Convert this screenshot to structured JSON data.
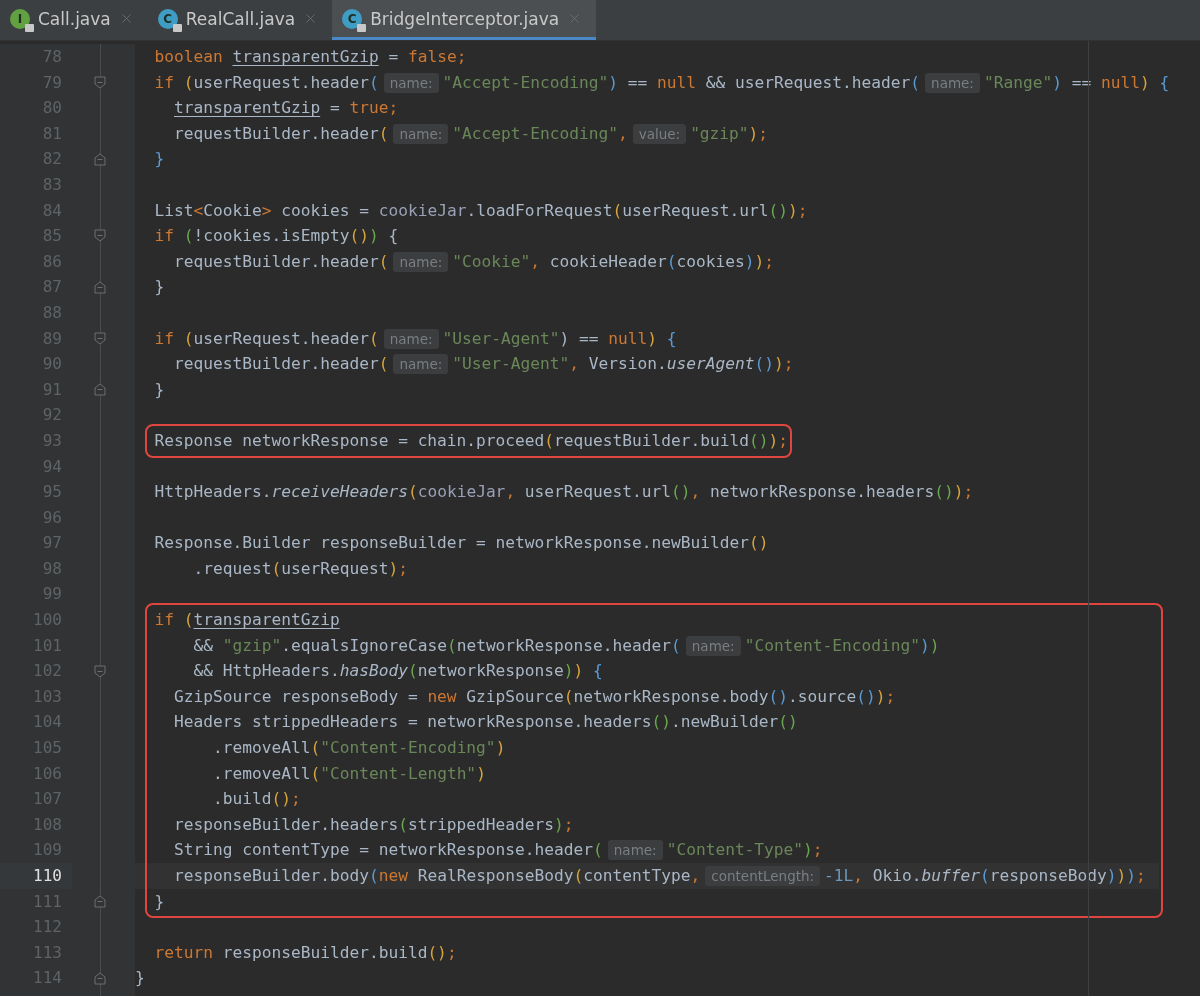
{
  "tabs": [
    {
      "label": "Call.java",
      "kind": "interface",
      "icon_letter": "I",
      "selected": false
    },
    {
      "label": "RealCall.java",
      "kind": "class",
      "icon_letter": "C",
      "selected": false
    },
    {
      "label": "BridgeInterceptor.java",
      "kind": "class",
      "icon_letter": "C",
      "selected": true
    }
  ],
  "segments": [
    {
      "kind": "code",
      "lines": [
        {
          "number": "78",
          "current": false,
          "tokens": [
            {
              "kind": "kw",
              "text": "  boolean "
            },
            {
              "kind": "var",
              "text": "transparentGzip"
            },
            {
              "kind": "txt",
              "text": " = "
            },
            {
              "kind": "kw",
              "text": "false"
            },
            {
              "kind": "punct",
              "text": ";"
            }
          ]
        },
        {
          "number": "79",
          "current": false,
          "fold": {
            "kind": "start"
          },
          "tokens": [
            {
              "kind": "kw",
              "text": "  if "
            },
            {
              "kind": "p1",
              "text": "("
            },
            {
              "kind": "txt",
              "text": "userRequest.header"
            },
            {
              "kind": "p2",
              "text": "("
            },
            {
              "kind": "hint",
              "text": "name:"
            },
            {
              "kind": "str",
              "text": "\"Accept-Encoding\""
            },
            {
              "kind": "p2",
              "text": ")"
            },
            {
              "kind": "txt",
              "text": " == "
            },
            {
              "kind": "kw",
              "text": "null"
            },
            {
              "kind": "txt",
              "text": " && userRequest.header"
            },
            {
              "kind": "p2",
              "text": "("
            },
            {
              "kind": "hint",
              "text": "name:"
            },
            {
              "kind": "str",
              "text": "\"Range\""
            },
            {
              "kind": "p2",
              "text": ")"
            },
            {
              "kind": "txt",
              "text": " == "
            },
            {
              "kind": "kw",
              "text": "null"
            },
            {
              "kind": "p1",
              "text": ") "
            },
            {
              "kind": "p2",
              "text": "{"
            }
          ]
        },
        {
          "number": "80",
          "current": false,
          "tokens": [
            {
              "kind": "var",
              "text": "    transparentGzip"
            },
            {
              "kind": "txt",
              "text": " = "
            },
            {
              "kind": "kw",
              "text": "true"
            },
            {
              "kind": "punct",
              "text": ";"
            }
          ]
        },
        {
          "number": "81",
          "current": false,
          "tokens": [
            {
              "kind": "txt",
              "text": "    requestBuilder.header"
            },
            {
              "kind": "p1",
              "text": "("
            },
            {
              "kind": "hint",
              "text": "name:"
            },
            {
              "kind": "str",
              "text": "\"Accept-Encoding\""
            },
            {
              "kind": "punct",
              "text": ","
            },
            {
              "kind": "hint",
              "text": "value:"
            },
            {
              "kind": "str",
              "text": "\"gzip\""
            },
            {
              "kind": "p1",
              "text": ")"
            },
            {
              "kind": "punct",
              "text": ";"
            }
          ]
        },
        {
          "number": "82",
          "current": false,
          "fold": {
            "kind": "end"
          },
          "tokens": [
            {
              "kind": "p2",
              "text": "  }"
            }
          ]
        },
        {
          "number": "83",
          "current": false
        },
        {
          "number": "84",
          "current": false,
          "tokens": [
            {
              "kind": "txt",
              "text": "  List"
            },
            {
              "kind": "kw",
              "text": "<"
            },
            {
              "kind": "txt",
              "text": "Cookie"
            },
            {
              "kind": "kw",
              "text": ">"
            },
            {
              "kind": "txt",
              "text": " cookies = "
            },
            {
              "kind": "field",
              "text": "cookieJar"
            },
            {
              "kind": "txt",
              "text": ".loadForRequest"
            },
            {
              "kind": "p1",
              "text": "("
            },
            {
              "kind": "txt",
              "text": "userRequest.url"
            },
            {
              "kind": "p3",
              "text": "()"
            },
            {
              "kind": "p1",
              "text": ")"
            },
            {
              "kind": "punct",
              "text": ";"
            }
          ]
        },
        {
          "number": "85",
          "current": false,
          "fold": {
            "kind": "start"
          },
          "tokens": [
            {
              "kind": "kw",
              "text": "  if "
            },
            {
              "kind": "p3",
              "text": "("
            },
            {
              "kind": "txt",
              "text": "!cookies.isEmpty"
            },
            {
              "kind": "p1",
              "text": "()"
            },
            {
              "kind": "p3",
              "text": ")"
            },
            {
              "kind": "txt",
              "text": " {"
            }
          ]
        },
        {
          "number": "86",
          "current": false,
          "tokens": [
            {
              "kind": "txt",
              "text": "    requestBuilder.header"
            },
            {
              "kind": "p1",
              "text": "("
            },
            {
              "kind": "hint",
              "text": "name:"
            },
            {
              "kind": "str",
              "text": "\"Cookie\""
            },
            {
              "kind": "punct",
              "text": ","
            },
            {
              "kind": "txt",
              "text": " cookieHeader"
            },
            {
              "kind": "p2",
              "text": "("
            },
            {
              "kind": "txt",
              "text": "cookies"
            },
            {
              "kind": "p2",
              "text": ")"
            },
            {
              "kind": "p1",
              "text": ")"
            },
            {
              "kind": "punct",
              "text": ";"
            }
          ]
        },
        {
          "number": "87",
          "current": false,
          "fold": {
            "kind": "end"
          },
          "tokens": [
            {
              "kind": "txt",
              "text": "  }"
            }
          ]
        },
        {
          "number": "88",
          "current": false
        },
        {
          "number": "89",
          "current": false,
          "fold": {
            "kind": "start"
          },
          "tokens": [
            {
              "kind": "kw",
              "text": "  if "
            },
            {
              "kind": "p1",
              "text": "("
            },
            {
              "kind": "txt",
              "text": "userRequest.header"
            },
            {
              "kind": "p1",
              "text": "("
            },
            {
              "kind": "hint",
              "text": "name:"
            },
            {
              "kind": "str",
              "text": "\"User-Agent\""
            },
            {
              "kind": "txt",
              "text": ")"
            },
            {
              "kind": "txt",
              "text": " == "
            },
            {
              "kind": "kw",
              "text": "null"
            },
            {
              "kind": "p1",
              "text": ") "
            },
            {
              "kind": "p2",
              "text": "{"
            }
          ]
        },
        {
          "number": "90",
          "current": false,
          "tokens": [
            {
              "kind": "txt",
              "text": "    requestBuilder.header"
            },
            {
              "kind": "p1",
              "text": "("
            },
            {
              "kind": "hint",
              "text": "name:"
            },
            {
              "kind": "str",
              "text": "\"User-Agent\""
            },
            {
              "kind": "punct",
              "text": ","
            },
            {
              "kind": "txt",
              "text": " Version."
            },
            {
              "kind": "static",
              "text": "userAgent"
            },
            {
              "kind": "p2",
              "text": "()"
            },
            {
              "kind": "p1",
              "text": ")"
            },
            {
              "kind": "punct",
              "text": ";"
            }
          ]
        },
        {
          "number": "91",
          "current": false,
          "fold": {
            "kind": "end"
          },
          "tokens": [
            {
              "kind": "txt",
              "text": "  }"
            }
          ]
        },
        {
          "number": "92",
          "current": false
        }
      ]
    },
    {
      "kind": "boxed",
      "fit_to_text": true,
      "lines": [
        {
          "number": "93",
          "current": false,
          "tokens": [
            {
              "kind": "txt",
              "text": "  Response networkResponse = chain.proceed"
            },
            {
              "kind": "p1",
              "text": "("
            },
            {
              "kind": "txt",
              "text": "requestBuilder.build"
            },
            {
              "kind": "p3",
              "text": "()"
            },
            {
              "kind": "p1",
              "text": ")"
            },
            {
              "kind": "punct",
              "text": ";"
            }
          ]
        }
      ]
    },
    {
      "kind": "code",
      "lines": [
        {
          "number": "94",
          "current": false
        },
        {
          "number": "95",
          "current": false,
          "tokens": [
            {
              "kind": "txt",
              "text": "  HttpHeaders."
            },
            {
              "kind": "static",
              "text": "receiveHeaders"
            },
            {
              "kind": "p1",
              "text": "("
            },
            {
              "kind": "field",
              "text": "cookieJar"
            },
            {
              "kind": "punct",
              "text": ","
            },
            {
              "kind": "txt",
              "text": " userRequest.url"
            },
            {
              "kind": "p3",
              "text": "()"
            },
            {
              "kind": "punct",
              "text": ","
            },
            {
              "kind": "txt",
              "text": " networkResponse.headers"
            },
            {
              "kind": "p3",
              "text": "()"
            },
            {
              "kind": "p1",
              "text": ")"
            },
            {
              "kind": "punct",
              "text": ";"
            }
          ]
        },
        {
          "number": "96",
          "current": false
        },
        {
          "number": "97",
          "current": false,
          "tokens": [
            {
              "kind": "txt",
              "text": "  Response.Builder responseBuilder = networkResponse.newBuilder"
            },
            {
              "kind": "p1",
              "text": "()"
            }
          ]
        },
        {
          "number": "98",
          "current": false,
          "tokens": [
            {
              "kind": "txt",
              "text": "      .request"
            },
            {
              "kind": "p1",
              "text": "("
            },
            {
              "kind": "txt",
              "text": "userRequest"
            },
            {
              "kind": "p1",
              "text": ")"
            },
            {
              "kind": "punct",
              "text": ";"
            }
          ]
        },
        {
          "number": "99",
          "current": false
        }
      ]
    },
    {
      "kind": "boxed",
      "fit_to_text": false,
      "lines": [
        {
          "number": "100",
          "current": false,
          "tokens": [
            {
              "kind": "kw",
              "text": "  if "
            },
            {
              "kind": "p1",
              "text": "("
            },
            {
              "kind": "var",
              "text": "transparentGzip"
            }
          ]
        },
        {
          "number": "101",
          "current": false,
          "tokens": [
            {
              "kind": "txt",
              "text": "      && "
            },
            {
              "kind": "str",
              "text": "\"gzip\""
            },
            {
              "kind": "txt",
              "text": ".equalsIgnoreCase"
            },
            {
              "kind": "p3",
              "text": "("
            },
            {
              "kind": "txt",
              "text": "networkResponse.header"
            },
            {
              "kind": "p2",
              "text": "("
            },
            {
              "kind": "hint",
              "text": "name:"
            },
            {
              "kind": "str",
              "text": "\"Content-Encoding\""
            },
            {
              "kind": "p2",
              "text": ")"
            },
            {
              "kind": "p3",
              "text": ")"
            }
          ]
        },
        {
          "number": "102",
          "current": false,
          "fold": {
            "kind": "start"
          },
          "tokens": [
            {
              "kind": "txt",
              "text": "      && HttpHeaders."
            },
            {
              "kind": "static",
              "text": "hasBody"
            },
            {
              "kind": "p3",
              "text": "("
            },
            {
              "kind": "txt",
              "text": "networkResponse"
            },
            {
              "kind": "p3",
              "text": ")"
            },
            {
              "kind": "p1",
              "text": ") "
            },
            {
              "kind": "p2",
              "text": "{"
            }
          ]
        },
        {
          "number": "103",
          "current": false,
          "tokens": [
            {
              "kind": "txt",
              "text": "    GzipSource responseBody = "
            },
            {
              "kind": "kw",
              "text": "new"
            },
            {
              "kind": "txt",
              "text": " GzipSource"
            },
            {
              "kind": "p1",
              "text": "("
            },
            {
              "kind": "txt",
              "text": "networkResponse.body"
            },
            {
              "kind": "p2",
              "text": "()"
            },
            {
              "kind": "txt",
              "text": ".source"
            },
            {
              "kind": "p2",
              "text": "()"
            },
            {
              "kind": "p1",
              "text": ")"
            },
            {
              "kind": "punct",
              "text": ";"
            }
          ]
        },
        {
          "number": "104",
          "current": false,
          "tokens": [
            {
              "kind": "txt",
              "text": "    Headers strippedHeaders = networkResponse.headers"
            },
            {
              "kind": "p3",
              "text": "()"
            },
            {
              "kind": "txt",
              "text": ".newBuilder"
            },
            {
              "kind": "p3",
              "text": "()"
            }
          ]
        },
        {
          "number": "105",
          "current": false,
          "tokens": [
            {
              "kind": "txt",
              "text": "        .removeAll"
            },
            {
              "kind": "p1",
              "text": "("
            },
            {
              "kind": "str",
              "text": "\"Content-Encoding\""
            },
            {
              "kind": "p1",
              "text": ")"
            }
          ]
        },
        {
          "number": "106",
          "current": false,
          "tokens": [
            {
              "kind": "txt",
              "text": "        .removeAll"
            },
            {
              "kind": "p1",
              "text": "("
            },
            {
              "kind": "str",
              "text": "\"Content-Length\""
            },
            {
              "kind": "p1",
              "text": ")"
            }
          ]
        },
        {
          "number": "107",
          "current": false,
          "tokens": [
            {
              "kind": "txt",
              "text": "        .build"
            },
            {
              "kind": "p1",
              "text": "()"
            },
            {
              "kind": "punct",
              "text": ";"
            }
          ]
        },
        {
          "number": "108",
          "current": false,
          "tokens": [
            {
              "kind": "txt",
              "text": "    responseBuilder.headers"
            },
            {
              "kind": "p3",
              "text": "("
            },
            {
              "kind": "txt",
              "text": "strippedHeaders"
            },
            {
              "kind": "p3",
              "text": ")"
            },
            {
              "kind": "punct",
              "text": ";"
            }
          ]
        },
        {
          "number": "109",
          "current": false,
          "tokens": [
            {
              "kind": "txt",
              "text": "    String contentType = networkResponse.header"
            },
            {
              "kind": "p3",
              "text": "("
            },
            {
              "kind": "hint",
              "text": "name:"
            },
            {
              "kind": "str",
              "text": "\"Content-Type\""
            },
            {
              "kind": "p3",
              "text": ")"
            },
            {
              "kind": "punct",
              "text": ";"
            }
          ]
        },
        {
          "number": "110",
          "current": true,
          "tokens": [
            {
              "kind": "txt",
              "text": "    responseBuilder.body"
            },
            {
              "kind": "p2",
              "text": "("
            },
            {
              "kind": "kw",
              "text": "new"
            },
            {
              "kind": "txt",
              "text": " RealResponseBody"
            },
            {
              "kind": "p1",
              "text": "("
            },
            {
              "kind": "txt",
              "text": "contentType"
            },
            {
              "kind": "punct",
              "text": ","
            },
            {
              "kind": "hint",
              "text": "contentLength:"
            },
            {
              "kind": "num",
              "text": "-1L"
            },
            {
              "kind": "punct",
              "text": ","
            },
            {
              "kind": "txt",
              "text": " Okio."
            },
            {
              "kind": "static",
              "text": "buffer"
            },
            {
              "kind": "p2",
              "text": "("
            },
            {
              "kind": "txt",
              "text": "responseBody"
            },
            {
              "kind": "p2",
              "text": ")"
            },
            {
              "kind": "p1",
              "text": ")"
            },
            {
              "kind": "p2",
              "text": ")"
            },
            {
              "kind": "punct",
              "text": ";"
            }
          ]
        },
        {
          "number": "111",
          "current": false,
          "fold": {
            "kind": "end"
          },
          "tokens": [
            {
              "kind": "txt",
              "text": "  }"
            }
          ]
        }
      ]
    },
    {
      "kind": "code",
      "lines": [
        {
          "number": "112",
          "current": false
        },
        {
          "number": "113",
          "current": false,
          "tokens": [
            {
              "kind": "kw",
              "text": "  return"
            },
            {
              "kind": "txt",
              "text": " responseBuilder.build"
            },
            {
              "kind": "p1",
              "text": "()"
            },
            {
              "kind": "punct",
              "text": ";"
            }
          ]
        },
        {
          "number": "114",
          "current": false,
          "fold": {
            "kind": "end"
          },
          "tokens": [
            {
              "kind": "txt",
              "text": "}"
            }
          ]
        }
      ]
    }
  ]
}
